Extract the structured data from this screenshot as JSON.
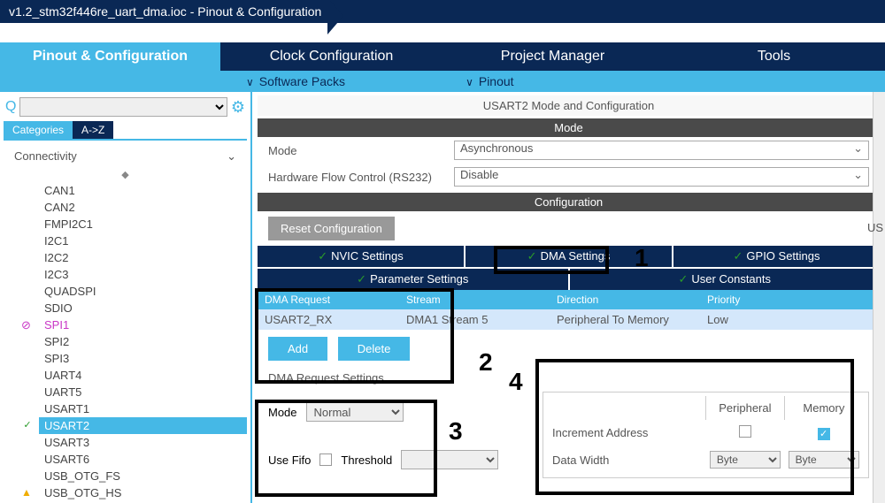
{
  "breadcrumb": {
    "file": "v1.2_stm32f446re_uart_dma.ioc",
    "section": "Pinout & Configuration"
  },
  "mainTabs": [
    "Pinout & Configuration",
    "Clock Configuration",
    "Project Manager",
    "Tools"
  ],
  "subTabs": [
    "Software Packs",
    "Pinout"
  ],
  "categoriesTabs": {
    "cat": "Categories",
    "az": "A->Z"
  },
  "categoryGroup": "Connectivity",
  "peripherals": [
    {
      "name": "CAN1",
      "state": ""
    },
    {
      "name": "CAN2",
      "state": ""
    },
    {
      "name": "FMPI2C1",
      "state": ""
    },
    {
      "name": "I2C1",
      "state": ""
    },
    {
      "name": "I2C2",
      "state": ""
    },
    {
      "name": "I2C3",
      "state": ""
    },
    {
      "name": "QUADSPI",
      "state": ""
    },
    {
      "name": "SDIO",
      "state": ""
    },
    {
      "name": "SPI1",
      "state": "deny"
    },
    {
      "name": "SPI2",
      "state": ""
    },
    {
      "name": "SPI3",
      "state": ""
    },
    {
      "name": "UART4",
      "state": ""
    },
    {
      "name": "UART5",
      "state": ""
    },
    {
      "name": "USART1",
      "state": ""
    },
    {
      "name": "USART2",
      "state": "active"
    },
    {
      "name": "USART3",
      "state": ""
    },
    {
      "name": "USART6",
      "state": ""
    },
    {
      "name": "USB_OTG_FS",
      "state": ""
    },
    {
      "name": "USB_OTG_HS",
      "state": "warn"
    }
  ],
  "panelTitle": "USART2 Mode and Configuration",
  "modeHeader": "Mode",
  "modeLabel": "Mode",
  "modeValue": "Asynchronous",
  "flowLabel": "Hardware Flow Control (RS232)",
  "flowValue": "Disable",
  "configHeader": "Configuration",
  "resetBtn": "Reset Configuration",
  "settingsTabs": {
    "nvic": "NVIC Settings",
    "dma": "DMA Settings",
    "gpio": "GPIO Settings",
    "param": "Parameter Settings",
    "user": "User Constants"
  },
  "dmaHeaders": {
    "req": "DMA Request",
    "stream": "Stream",
    "dir": "Direction",
    "prio": "Priority"
  },
  "dmaRow": {
    "req": "USART2_RX",
    "stream": "DMA1 Stream 5",
    "dir": "Peripheral To Memory",
    "prio": "Low"
  },
  "addBtn": "Add",
  "delBtn": "Delete",
  "reqSettingsLabel": "DMA Request Settings",
  "dmaModeLabel": "Mode",
  "dmaModeValue": "Normal",
  "useFifoLabel": "Use Fifo",
  "thresholdLabel": "Threshold",
  "incrHeaders": {
    "periph": "Peripheral",
    "mem": "Memory"
  },
  "incrAddrLabel": "Increment Address",
  "dataWidthLabel": "Data Width",
  "byteValue": "Byte",
  "annotations": {
    "a1": "1",
    "a2": "2",
    "a3": "3",
    "a4": "4"
  },
  "rightCut": "US"
}
